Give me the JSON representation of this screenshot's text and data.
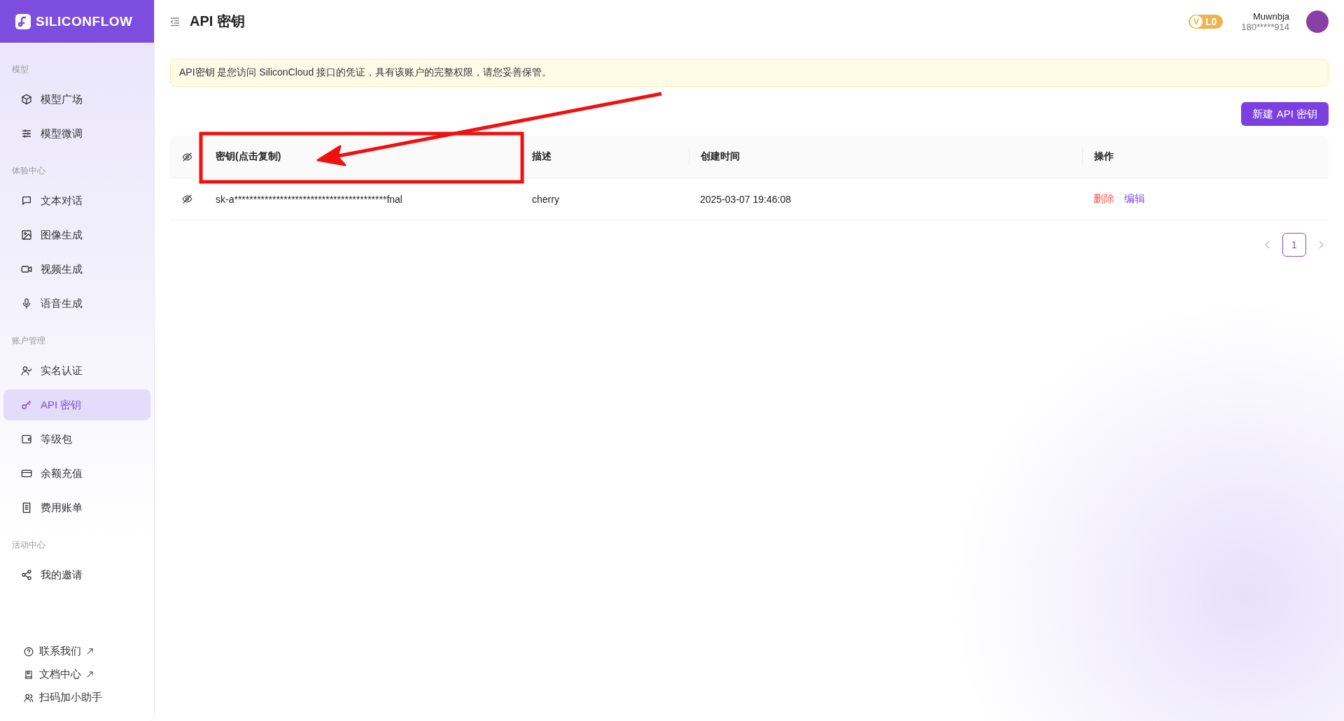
{
  "brand": {
    "logo_text": "SILICONFLOW"
  },
  "header": {
    "title": "API 密钥",
    "level_badge": {
      "letter": "V",
      "label": "L0"
    },
    "user": {
      "name": "Muwnbja",
      "phone": "180*****914"
    }
  },
  "sidebar": {
    "sections": [
      {
        "label": "模型",
        "items": [
          {
            "label": "模型广场",
            "kind": "cube",
            "selected": false
          },
          {
            "label": "模型微调",
            "kind": "sliders",
            "selected": false
          }
        ]
      },
      {
        "label": "体验中心",
        "items": [
          {
            "label": "文本对话",
            "kind": "chat",
            "selected": false
          },
          {
            "label": "图像生成",
            "kind": "image",
            "selected": false
          },
          {
            "label": "视频生成",
            "kind": "video",
            "selected": false
          },
          {
            "label": "语音生成",
            "kind": "mic",
            "selected": false
          }
        ]
      },
      {
        "label": "账户管理",
        "items": [
          {
            "label": "实名认证",
            "kind": "user-check",
            "selected": false
          },
          {
            "label": "API 密钥",
            "kind": "key",
            "selected": true
          },
          {
            "label": "等级包",
            "kind": "wallet",
            "selected": false
          },
          {
            "label": "余额充值",
            "kind": "card",
            "selected": false
          },
          {
            "label": "费用账单",
            "kind": "receipt",
            "selected": false
          }
        ]
      },
      {
        "label": "活动中心",
        "items": [
          {
            "label": "我的邀请",
            "kind": "share",
            "selected": false
          }
        ]
      }
    ],
    "footer_links": [
      {
        "label": "联系我们",
        "kind": "help",
        "external": true
      },
      {
        "label": "文档中心",
        "kind": "book",
        "external": true
      },
      {
        "label": "扫码加小助手",
        "kind": "users",
        "external": false
      }
    ]
  },
  "notice": "API密钥 是您访问 SiliconCloud 接口的凭证，具有该账户的完整权限，请您妥善保管。",
  "new_key_button": "新建 API 密钥",
  "table": {
    "columns": [
      "密钥(点击复制)",
      "描述",
      "创建时间",
      "操作"
    ],
    "rows": [
      {
        "key": "sk-a****************************************fnal",
        "description": "cherry",
        "created": "2025-03-07 19:46:08",
        "actions": [
          {
            "label": "删除",
            "kind": "danger"
          },
          {
            "label": "编辑",
            "kind": "primary"
          }
        ]
      }
    ]
  },
  "pagination": {
    "pages": [
      {
        "label": "1",
        "selected": true
      }
    ]
  }
}
